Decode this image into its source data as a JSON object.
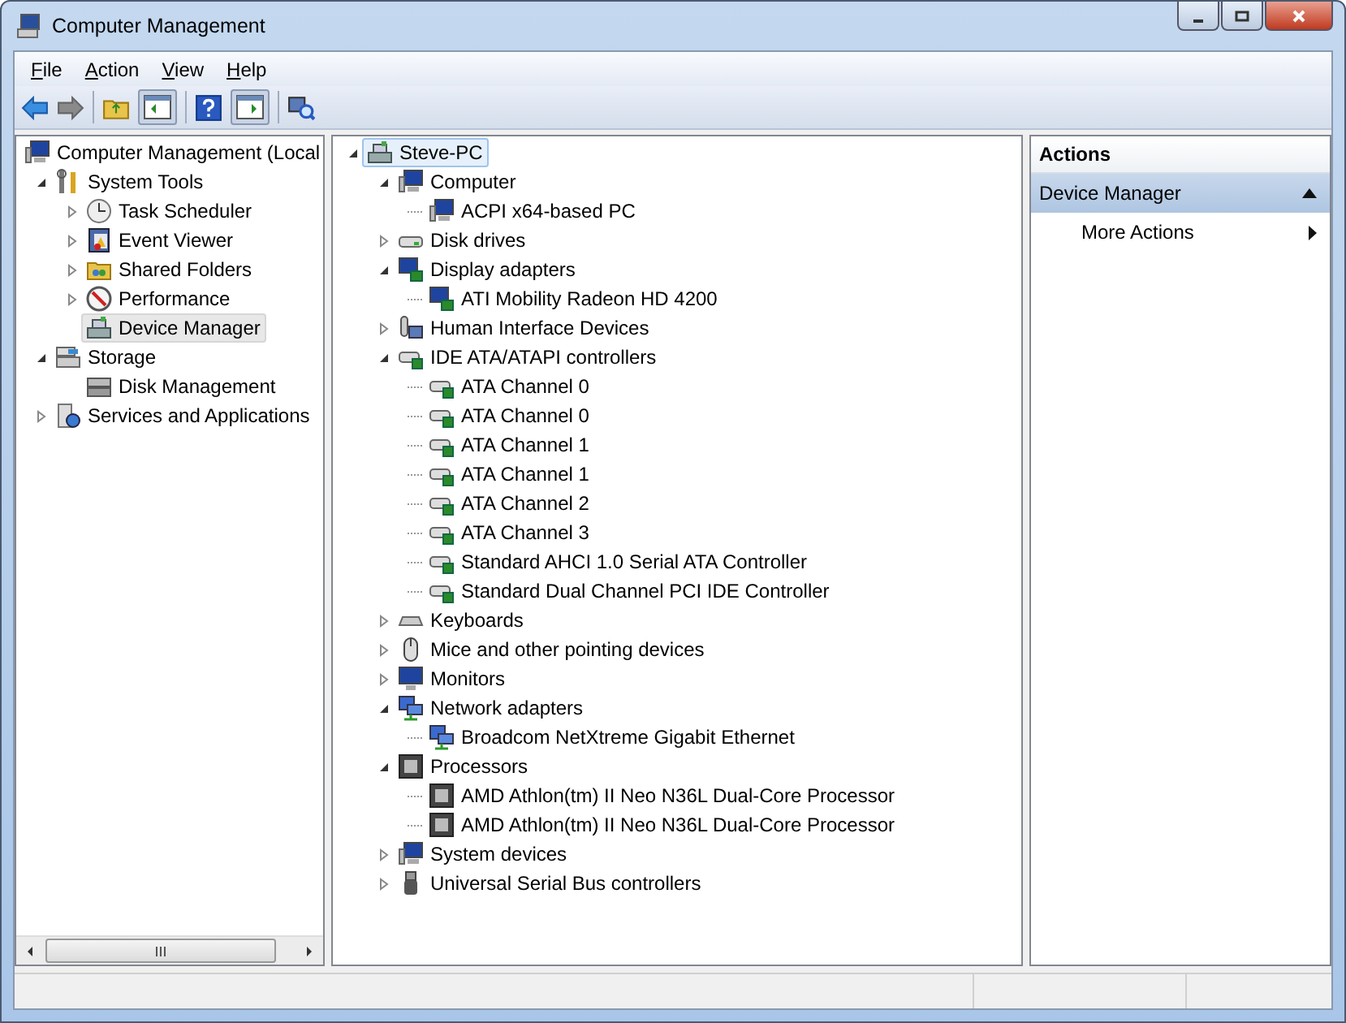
{
  "window": {
    "title": "Computer Management"
  },
  "menu": [
    "File",
    "Action",
    "View",
    "Help"
  ],
  "nav_tree": [
    {
      "label": "Computer Management (Local",
      "kind": "computer",
      "selected": false,
      "children": [
        {
          "label": "System Tools",
          "kind": "tools",
          "expanded": true,
          "selected": false,
          "children": [
            {
              "label": "Task Scheduler",
              "kind": "clock",
              "expanded": false,
              "selected": false
            },
            {
              "label": "Event Viewer",
              "kind": "event",
              "expanded": false,
              "selected": false
            },
            {
              "label": "Shared Folders",
              "kind": "shared",
              "expanded": false,
              "selected": false
            },
            {
              "label": "Performance",
              "kind": "performance",
              "expanded": false,
              "selected": false
            },
            {
              "label": "Device Manager",
              "kind": "devmgr",
              "selected": true
            }
          ]
        },
        {
          "label": "Storage",
          "kind": "storage",
          "expanded": true,
          "selected": false,
          "children": [
            {
              "label": "Disk Management",
              "kind": "diskmgmt",
              "selected": false
            }
          ]
        },
        {
          "label": "Services and Applications",
          "kind": "services",
          "expanded": false,
          "selected": false
        }
      ]
    }
  ],
  "device_tree": [
    {
      "label": "Steve-PC",
      "kind": "devmgr",
      "expanded": true,
      "selected": true,
      "children": [
        {
          "label": "Computer",
          "kind": "computer",
          "expanded": true,
          "selected": false,
          "children": [
            {
              "label": "ACPI x64-based PC",
              "kind": "computer",
              "selected": false
            }
          ]
        },
        {
          "label": "Disk drives",
          "kind": "disk",
          "expanded": false,
          "selected": false
        },
        {
          "label": "Display adapters",
          "kind": "display",
          "expanded": true,
          "selected": false,
          "children": [
            {
              "label": "ATI Mobility Radeon HD 4200",
              "kind": "display",
              "selected": false
            }
          ]
        },
        {
          "label": "Human Interface Devices",
          "kind": "hid",
          "expanded": false,
          "selected": false
        },
        {
          "label": "IDE ATA/ATAPI controllers",
          "kind": "ide",
          "expanded": true,
          "selected": false,
          "children": [
            {
              "label": "ATA Channel 0",
              "kind": "ide",
              "selected": false
            },
            {
              "label": "ATA Channel 0",
              "kind": "ide",
              "selected": false
            },
            {
              "label": "ATA Channel 1",
              "kind": "ide",
              "selected": false
            },
            {
              "label": "ATA Channel 1",
              "kind": "ide",
              "selected": false
            },
            {
              "label": "ATA Channel 2",
              "kind": "ide",
              "selected": false
            },
            {
              "label": "ATA Channel 3",
              "kind": "ide",
              "selected": false
            },
            {
              "label": "Standard AHCI 1.0 Serial ATA Controller",
              "kind": "ide",
              "selected": false
            },
            {
              "label": "Standard Dual Channel PCI IDE Controller",
              "kind": "ide",
              "selected": false
            }
          ]
        },
        {
          "label": "Keyboards",
          "kind": "keyboard",
          "expanded": false,
          "selected": false
        },
        {
          "label": "Mice and other pointing devices",
          "kind": "mouse",
          "expanded": false,
          "selected": false
        },
        {
          "label": "Monitors",
          "kind": "monitor",
          "expanded": false,
          "selected": false
        },
        {
          "label": "Network adapters",
          "kind": "network",
          "expanded": true,
          "selected": false,
          "children": [
            {
              "label": "Broadcom NetXtreme Gigabit Ethernet",
              "kind": "network",
              "selected": false
            }
          ]
        },
        {
          "label": "Processors",
          "kind": "cpu",
          "expanded": true,
          "selected": false,
          "children": [
            {
              "label": "AMD Athlon(tm) II Neo N36L Dual-Core Processor",
              "kind": "cpu",
              "selected": false
            },
            {
              "label": "AMD Athlon(tm) II Neo N36L Dual-Core Processor",
              "kind": "cpu",
              "selected": false
            }
          ]
        },
        {
          "label": "System devices",
          "kind": "computer",
          "expanded": false,
          "selected": false
        },
        {
          "label": "Universal Serial Bus controllers",
          "kind": "usb",
          "expanded": false,
          "selected": false
        }
      ]
    }
  ],
  "actions": {
    "title": "Actions",
    "section": {
      "label": "Device Manager",
      "expanded": true
    },
    "items": [
      "More Actions"
    ]
  }
}
